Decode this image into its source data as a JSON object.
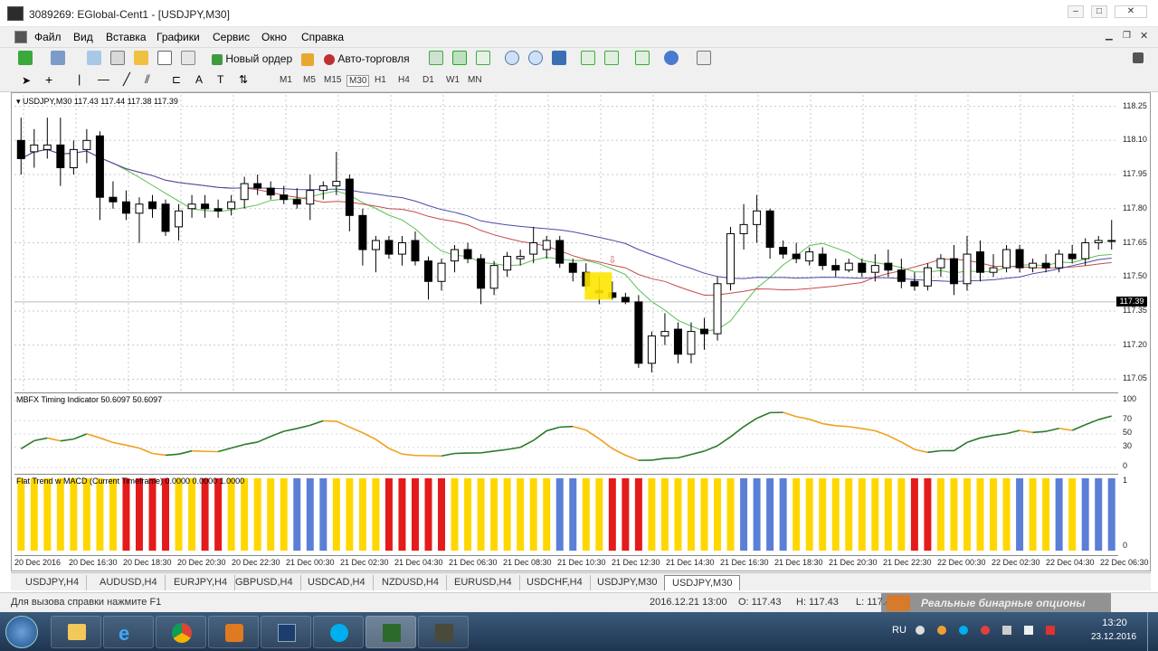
{
  "window": {
    "title": "3089269: EGlobal-Cent1 - [USDJPY,M30]"
  },
  "menu": [
    "Файл",
    "Вид",
    "Вставка",
    "Графики",
    "Сервис",
    "Окно",
    "Справка"
  ],
  "toolbar": {
    "new_order": "Новый ордер",
    "autotrading": "Авто-торговля"
  },
  "timeframes": [
    "M1",
    "M5",
    "M15",
    "M30",
    "H1",
    "H4",
    "D1",
    "W1",
    "MN"
  ],
  "timeframe_selected": "M30",
  "chart": {
    "header": "USDJPY,M30  117.43 117.44 117.38 117.39",
    "price_ticks": [
      "118.25",
      "118.10",
      "117.95",
      "117.80",
      "117.65",
      "117.50",
      "117.35",
      "117.20",
      "117.05"
    ],
    "current_price": "117.39",
    "candles": [
      {
        "o": 118.1,
        "h": 118.2,
        "l": 117.95,
        "c": 118.02
      },
      {
        "o": 118.05,
        "h": 118.15,
        "l": 117.98,
        "c": 118.08
      },
      {
        "o": 118.06,
        "h": 118.2,
        "l": 118.02,
        "c": 118.08
      },
      {
        "o": 118.08,
        "h": 118.2,
        "l": 117.9,
        "c": 117.98
      },
      {
        "o": 117.98,
        "h": 118.1,
        "l": 117.95,
        "c": 118.06
      },
      {
        "o": 118.06,
        "h": 118.15,
        "l": 118.0,
        "c": 118.1
      },
      {
        "o": 118.12,
        "h": 118.14,
        "l": 117.75,
        "c": 117.85
      },
      {
        "o": 117.85,
        "h": 117.92,
        "l": 117.8,
        "c": 117.83
      },
      {
        "o": 117.83,
        "h": 117.88,
        "l": 117.75,
        "c": 117.78
      },
      {
        "o": 117.78,
        "h": 117.85,
        "l": 117.65,
        "c": 117.82
      },
      {
        "o": 117.83,
        "h": 117.86,
        "l": 117.76,
        "c": 117.8
      },
      {
        "o": 117.82,
        "h": 117.84,
        "l": 117.68,
        "c": 117.7
      },
      {
        "o": 117.72,
        "h": 117.82,
        "l": 117.66,
        "c": 117.79
      },
      {
        "o": 117.8,
        "h": 117.86,
        "l": 117.76,
        "c": 117.82
      },
      {
        "o": 117.82,
        "h": 117.86,
        "l": 117.76,
        "c": 117.8
      },
      {
        "o": 117.8,
        "h": 117.84,
        "l": 117.76,
        "c": 117.79
      },
      {
        "o": 117.8,
        "h": 117.86,
        "l": 117.77,
        "c": 117.83
      },
      {
        "o": 117.84,
        "h": 117.94,
        "l": 117.8,
        "c": 117.91
      },
      {
        "o": 117.91,
        "h": 117.95,
        "l": 117.86,
        "c": 117.89
      },
      {
        "o": 117.89,
        "h": 117.92,
        "l": 117.84,
        "c": 117.86
      },
      {
        "o": 117.86,
        "h": 117.9,
        "l": 117.82,
        "c": 117.84
      },
      {
        "o": 117.84,
        "h": 117.89,
        "l": 117.8,
        "c": 117.82
      },
      {
        "o": 117.82,
        "h": 117.95,
        "l": 117.75,
        "c": 117.88
      },
      {
        "o": 117.88,
        "h": 117.92,
        "l": 117.84,
        "c": 117.9
      },
      {
        "o": 117.9,
        "h": 118.05,
        "l": 117.86,
        "c": 117.92
      },
      {
        "o": 117.93,
        "h": 117.95,
        "l": 117.7,
        "c": 117.77
      },
      {
        "o": 117.77,
        "h": 117.8,
        "l": 117.55,
        "c": 117.62
      },
      {
        "o": 117.62,
        "h": 117.68,
        "l": 117.52,
        "c": 117.66
      },
      {
        "o": 117.66,
        "h": 117.68,
        "l": 117.58,
        "c": 117.6
      },
      {
        "o": 117.6,
        "h": 117.68,
        "l": 117.55,
        "c": 117.65
      },
      {
        "o": 117.66,
        "h": 117.7,
        "l": 117.55,
        "c": 117.57
      },
      {
        "o": 117.57,
        "h": 117.59,
        "l": 117.4,
        "c": 117.48
      },
      {
        "o": 117.48,
        "h": 117.58,
        "l": 117.44,
        "c": 117.56
      },
      {
        "o": 117.57,
        "h": 117.64,
        "l": 117.52,
        "c": 117.62
      },
      {
        "o": 117.62,
        "h": 117.65,
        "l": 117.56,
        "c": 117.58
      },
      {
        "o": 117.58,
        "h": 117.6,
        "l": 117.38,
        "c": 117.45
      },
      {
        "o": 117.45,
        "h": 117.57,
        "l": 117.42,
        "c": 117.55
      },
      {
        "o": 117.53,
        "h": 117.61,
        "l": 117.5,
        "c": 117.59
      },
      {
        "o": 117.58,
        "h": 117.62,
        "l": 117.55,
        "c": 117.59
      },
      {
        "o": 117.6,
        "h": 117.72,
        "l": 117.56,
        "c": 117.65
      },
      {
        "o": 117.62,
        "h": 117.68,
        "l": 117.58,
        "c": 117.66
      },
      {
        "o": 117.66,
        "h": 117.68,
        "l": 117.54,
        "c": 117.56
      },
      {
        "o": 117.56,
        "h": 117.58,
        "l": 117.48,
        "c": 117.52
      },
      {
        "o": 117.52,
        "h": 117.56,
        "l": 117.44,
        "c": 117.46
      },
      {
        "o": 117.44,
        "h": 117.5,
        "l": 117.38,
        "c": 117.43
      },
      {
        "o": 117.43,
        "h": 117.48,
        "l": 117.4,
        "c": 117.41
      },
      {
        "o": 117.41,
        "h": 117.43,
        "l": 117.38,
        "c": 117.39
      },
      {
        "o": 117.39,
        "h": 117.42,
        "l": 117.1,
        "c": 117.12
      },
      {
        "o": 117.12,
        "h": 117.26,
        "l": 117.08,
        "c": 117.24
      },
      {
        "o": 117.24,
        "h": 117.34,
        "l": 117.2,
        "c": 117.26
      },
      {
        "o": 117.27,
        "h": 117.3,
        "l": 117.12,
        "c": 117.16
      },
      {
        "o": 117.16,
        "h": 117.3,
        "l": 117.12,
        "c": 117.26
      },
      {
        "o": 117.27,
        "h": 117.32,
        "l": 117.18,
        "c": 117.25
      },
      {
        "o": 117.25,
        "h": 117.5,
        "l": 117.22,
        "c": 117.47
      },
      {
        "o": 117.47,
        "h": 117.72,
        "l": 117.44,
        "c": 117.69
      },
      {
        "o": 117.69,
        "h": 117.82,
        "l": 117.62,
        "c": 117.73
      },
      {
        "o": 117.73,
        "h": 117.86,
        "l": 117.65,
        "c": 117.79
      },
      {
        "o": 117.79,
        "h": 117.8,
        "l": 117.58,
        "c": 117.63
      },
      {
        "o": 117.63,
        "h": 117.66,
        "l": 117.58,
        "c": 117.6
      },
      {
        "o": 117.6,
        "h": 117.65,
        "l": 117.56,
        "c": 117.58
      },
      {
        "o": 117.57,
        "h": 117.63,
        "l": 117.55,
        "c": 117.61
      },
      {
        "o": 117.6,
        "h": 117.63,
        "l": 117.53,
        "c": 117.55
      },
      {
        "o": 117.55,
        "h": 117.58,
        "l": 117.5,
        "c": 117.53
      },
      {
        "o": 117.53,
        "h": 117.58,
        "l": 117.52,
        "c": 117.56
      },
      {
        "o": 117.56,
        "h": 117.58,
        "l": 117.5,
        "c": 117.52
      },
      {
        "o": 117.52,
        "h": 117.6,
        "l": 117.48,
        "c": 117.55
      },
      {
        "o": 117.56,
        "h": 117.62,
        "l": 117.5,
        "c": 117.53
      },
      {
        "o": 117.53,
        "h": 117.58,
        "l": 117.45,
        "c": 117.48
      },
      {
        "o": 117.48,
        "h": 117.52,
        "l": 117.44,
        "c": 117.46
      },
      {
        "o": 117.46,
        "h": 117.56,
        "l": 117.44,
        "c": 117.54
      },
      {
        "o": 117.54,
        "h": 117.6,
        "l": 117.5,
        "c": 117.58
      },
      {
        "o": 117.58,
        "h": 117.64,
        "l": 117.42,
        "c": 117.47
      },
      {
        "o": 117.47,
        "h": 117.68,
        "l": 117.44,
        "c": 117.6
      },
      {
        "o": 117.61,
        "h": 117.66,
        "l": 117.48,
        "c": 117.52
      },
      {
        "o": 117.52,
        "h": 117.6,
        "l": 117.5,
        "c": 117.54
      },
      {
        "o": 117.54,
        "h": 117.64,
        "l": 117.52,
        "c": 117.62
      },
      {
        "o": 117.62,
        "h": 117.64,
        "l": 117.52,
        "c": 117.54
      },
      {
        "o": 117.54,
        "h": 117.58,
        "l": 117.52,
        "c": 117.56
      },
      {
        "o": 117.56,
        "h": 117.6,
        "l": 117.52,
        "c": 117.54
      },
      {
        "o": 117.54,
        "h": 117.62,
        "l": 117.52,
        "c": 117.6
      },
      {
        "o": 117.6,
        "h": 117.64,
        "l": 117.56,
        "c": 117.58
      },
      {
        "o": 117.58,
        "h": 117.67,
        "l": 117.55,
        "c": 117.65
      },
      {
        "o": 117.65,
        "h": 117.68,
        "l": 117.62,
        "c": 117.66
      },
      {
        "o": 117.66,
        "h": 117.75,
        "l": 117.62,
        "c": 117.66
      }
    ]
  },
  "indicator1": {
    "label": "MBFX Timing Indicator 50.6097 50.6097",
    "ticks": [
      "100",
      "70",
      "50",
      "30",
      "0"
    ]
  },
  "indicator2": {
    "label": "Flat Trend w MACD (Current Timeframe) 0.0000 0.0000 1.0000",
    "ticks": [
      "1",
      "0"
    ]
  },
  "time_axis": [
    "20 Dec 2016",
    "20 Dec 16:30",
    "20 Dec 18:30",
    "20 Dec 20:30",
    "20 Dec 22:30",
    "21 Dec 00:30",
    "21 Dec 02:30",
    "21 Dec 04:30",
    "21 Dec 06:30",
    "21 Dec 08:30",
    "21 Dec 10:30",
    "21 Dec 12:30",
    "21 Dec 14:30",
    "21 Dec 16:30",
    "21 Dec 18:30",
    "21 Dec 20:30",
    "21 Dec 22:30",
    "22 Dec 00:30",
    "22 Dec 02:30",
    "22 Dec 04:30",
    "22 Dec 06:30"
  ],
  "tabs": [
    "USDJPY,H4",
    "AUDUSD,H4",
    "EURJPY,H4",
    "GBPUSD,H4",
    "USDCAD,H4",
    "NZDUSD,H4",
    "EURUSD,H4",
    "USDCHF,H4",
    "USDJPY,M30",
    "USDJPY,M30"
  ],
  "active_tab": 9,
  "status": {
    "help": "Для вызова справки нажмите F1",
    "datetime": "2016.12.21 13:00",
    "open": "O: 117.43",
    "high": "H: 117.43",
    "low": "L: 117.4",
    "watermark": "Реальные бинарные опционы"
  },
  "tray": {
    "lang": "RU",
    "time": "13:20",
    "date": "23.12.2016"
  },
  "colors": {
    "yellow": "#ffd700",
    "red": "#e41b1b",
    "blue": "#5b7fd6",
    "ma_green": "#58c24f",
    "ma_red": "#c84a4a",
    "ma_blue": "#4a4aa8"
  }
}
